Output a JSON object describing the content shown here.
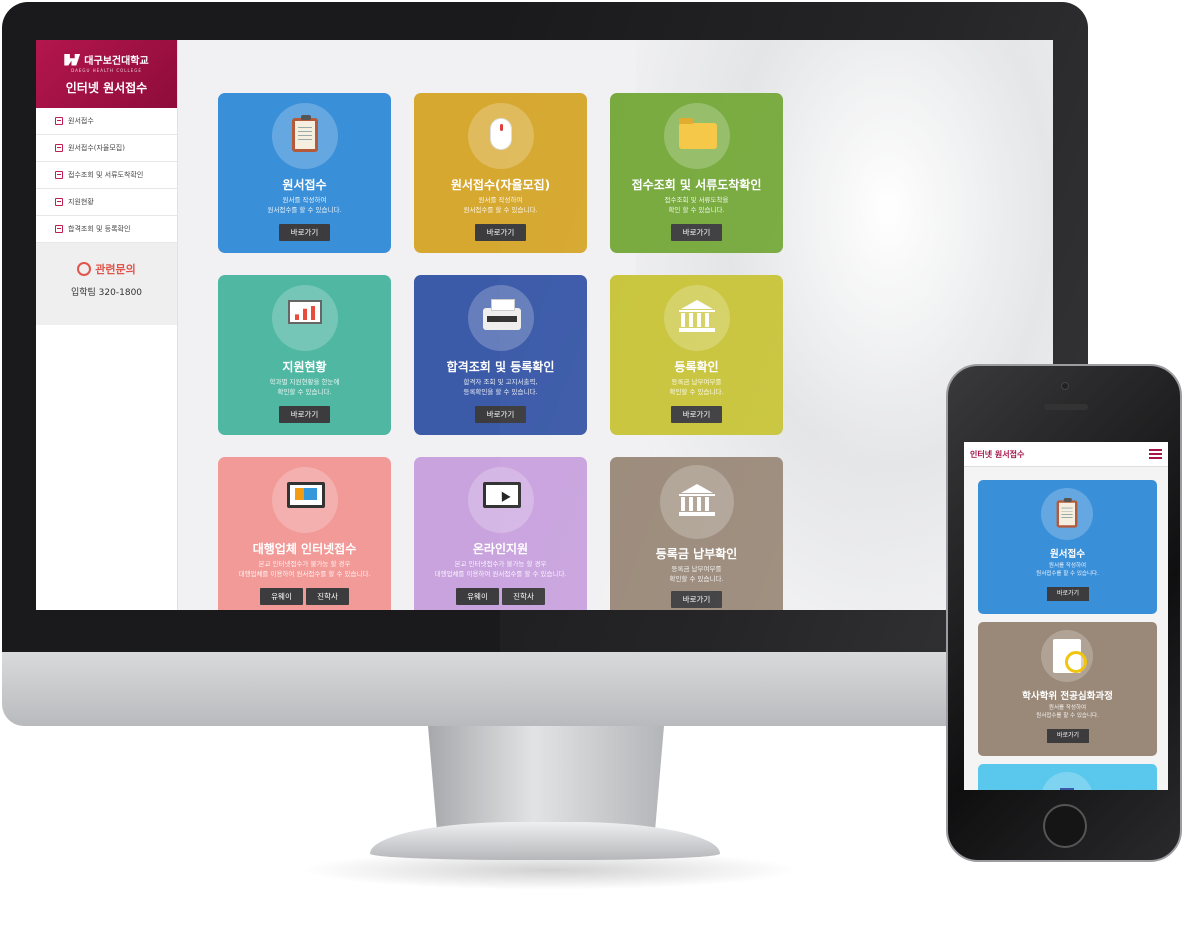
{
  "desktop": {
    "brand": {
      "logo_text": "대구보건대학교",
      "logo_sub": "DAEGU HEALTH COLLEGE",
      "title": "인터넷 원서접수"
    },
    "menu": [
      {
        "label": "원서접수"
      },
      {
        "label": "원서접수(자율모집)"
      },
      {
        "label": "접수조회 및 서류도착확인"
      },
      {
        "label": "지원현황"
      },
      {
        "label": "합격조회 및 등록확인"
      }
    ],
    "contact": {
      "title": "관련문의",
      "phone": "입학팀 320-1800"
    },
    "cards": [
      {
        "title": "원서접수",
        "desc": "원서를 작성하여\n원서접수를 할 수 있습니다.",
        "buttons": [
          "바로가기"
        ],
        "color": "#3a8fd9",
        "icon": "clipboard-icon"
      },
      {
        "title": "원서접수(자율모집)",
        "desc": "원서를 작성하여\n원서접수를 할 수 있습니다.",
        "buttons": [
          "바로가기"
        ],
        "color": "#d6a830",
        "icon": "mouse-icon"
      },
      {
        "title": "접수조회 및 서류도착확인",
        "desc": "접수조회 및 서류도착을\n확인 할 수 있습니다.",
        "buttons": [
          "바로가기"
        ],
        "color": "#76a93c",
        "icon": "folder-icon"
      },
      {
        "title": "지원현황",
        "desc": "학과별 지원현황을 한눈에\n확인할 수 있습니다.",
        "buttons": [
          "바로가기"
        ],
        "color": "#4fb7a2",
        "icon": "chart-board-icon"
      },
      {
        "title": "합격조회 및 등록확인",
        "desc": "합격자 조회 및 고지서출력,\n등록확인을 할 수 있습니다.",
        "buttons": [
          "바로가기"
        ],
        "color": "#3b5aa8",
        "icon": "printer-icon"
      },
      {
        "title": "등록확인",
        "desc": "등록금 납부여부를\n확인할 수 있습니다.",
        "buttons": [
          "바로가기"
        ],
        "color": "#c8c43a",
        "icon": "bank-icon"
      },
      {
        "title": "대행업체 인터넷접수",
        "desc": "본교 인터넷접수가 불가능 할 경우\n대행업체를 이용하여 원서접수를 할 수 있습니다.",
        "buttons": [
          "유웨이",
          "진학사"
        ],
        "color": "#f19a98",
        "icon": "monitor-chart-icon"
      },
      {
        "title": "온라인지원",
        "desc": "본교 인터넷접수가 불가능 할 경우\n대행업체를 이용하여 원서접수를 할 수 있습니다.",
        "buttons": [
          "유웨이",
          "진학사"
        ],
        "color": "#c9a3de",
        "icon": "monitor-cursor-icon"
      },
      {
        "title": "등록금 납부확인",
        "desc": "등록금 납부여부를\n확인할 수 있습니다.",
        "buttons": [
          "바로가기"
        ],
        "color": "#9a8979",
        "icon": "bank-icon"
      }
    ]
  },
  "mobile": {
    "header_title": "인터넷 원서접수",
    "cards": [
      {
        "title": "원서접수",
        "desc": "원서를 작성하여\n원서접수를 할 수 있습니다.",
        "button": "바로가기",
        "color": "#3a8fd9",
        "icon": "clipboard-icon"
      },
      {
        "title": "학사학위 전공심화과정",
        "desc": "원서를 작성하여\n원서접수를 할 수 있습니다.",
        "button": "바로가기",
        "color": "#9a8979",
        "icon": "document-search-icon"
      },
      {
        "title": "",
        "desc": "",
        "button": "",
        "color": "#5ac8ec",
        "icon": "books-icon"
      }
    ]
  }
}
